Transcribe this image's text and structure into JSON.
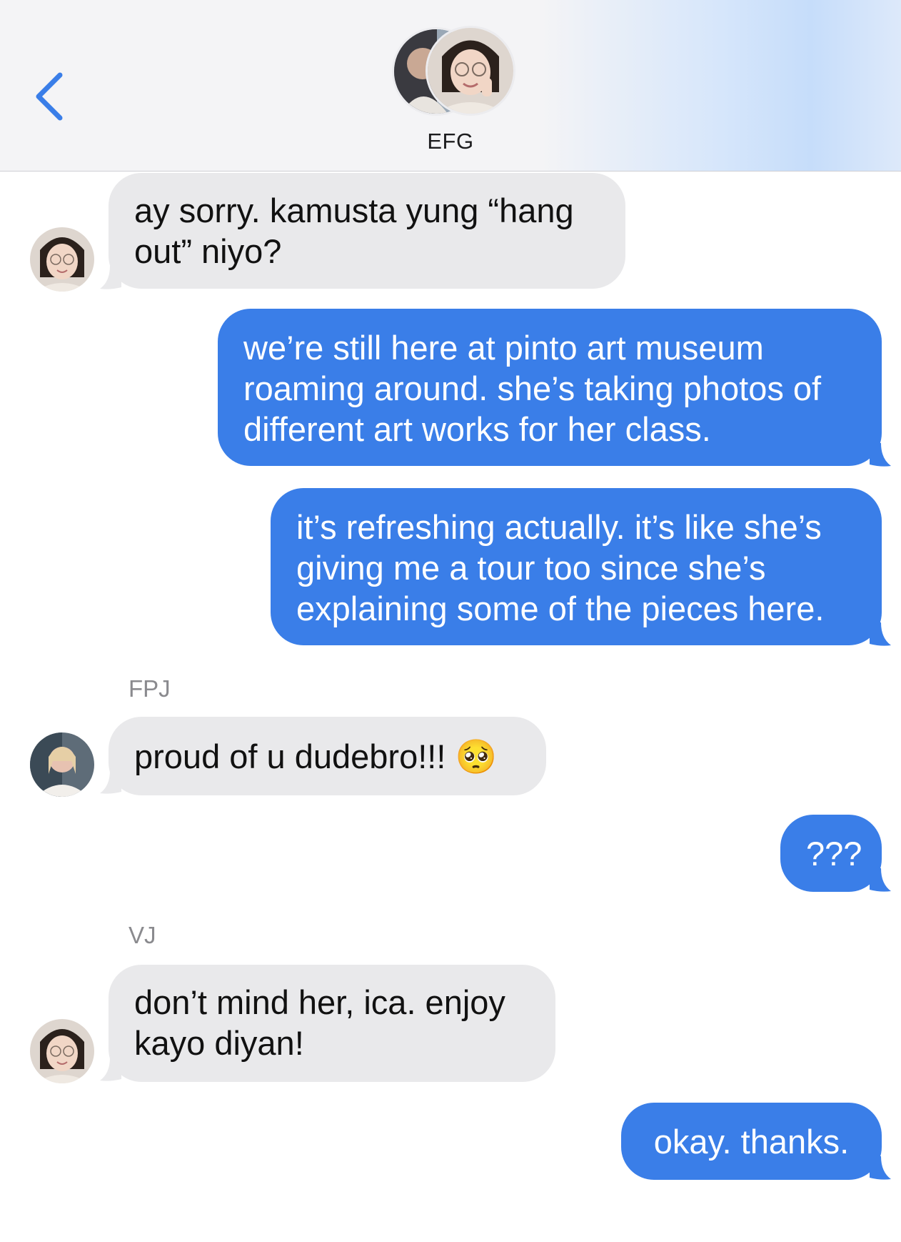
{
  "header": {
    "group_name": "EFG",
    "back_icon": "chevron-left-icon",
    "accent_color": "#3a7ee8"
  },
  "messages": [
    {
      "direction": "incoming",
      "sender": "",
      "text": "ay sorry. kamusta yung “hang\nout” niyo?"
    },
    {
      "direction": "outgoing",
      "text": "we’re still here at pinto art museum\nroaming around. she’s taking photos of\ndifferent art works for her class."
    },
    {
      "direction": "outgoing",
      "text": "it’s refreshing actually. it’s like she’s\ngiving me a tour too since she’s\nexplaining some of the pieces here."
    },
    {
      "direction": "incoming",
      "sender": "FPJ",
      "text": "proud of u dudebro!!! 🥺"
    },
    {
      "direction": "outgoing",
      "text": "???"
    },
    {
      "direction": "incoming",
      "sender": "VJ",
      "text": "don’t mind her, ica. enjoy\nkayo diyan!"
    },
    {
      "direction": "outgoing",
      "text": "okay. thanks."
    }
  ],
  "colors": {
    "incoming_bubble": "#e9e9eb",
    "outgoing_bubble": "#3a7ee8",
    "sender_label": "#8a8a8e"
  }
}
